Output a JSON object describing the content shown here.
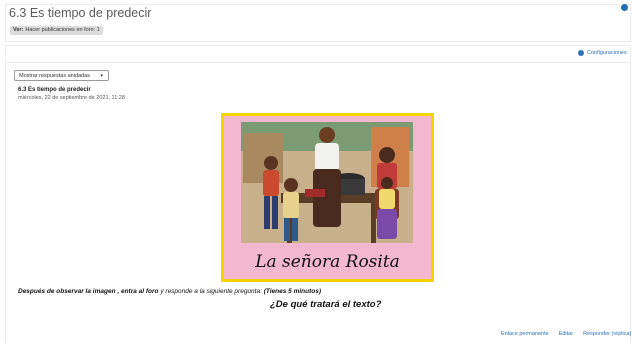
{
  "header": {
    "title": "6.3 Es tiempo de predecir",
    "completion_label": "Ver:",
    "completion_text": "Hacer publicaciones en foro: 1"
  },
  "toolbar": {
    "settings_label": "Configuraciones",
    "display_mode": "Mostrar respuestas anidadas"
  },
  "post": {
    "subject": "6.3 Es tiempo de predecir",
    "date": "miércoles, 22 de septiembre de 2021, 11:28",
    "image_caption": "La señora Rosita",
    "instructions_a": "Después de observar la imagen ,",
    "instructions_b": "entra al foro",
    "instructions_c": "y responde a la siguiente pregunta:",
    "instructions_d": "(Tienes 5 minutos)",
    "question": "¿De qué tratará el texto?"
  },
  "actions": {
    "permalink": "Enlace permanente",
    "edit": "Editar",
    "reply": "Responder (réplica)"
  },
  "colors": {
    "link": "#2b72b6",
    "image_frame": "#f6d400",
    "image_background": "#f3b7d0"
  }
}
